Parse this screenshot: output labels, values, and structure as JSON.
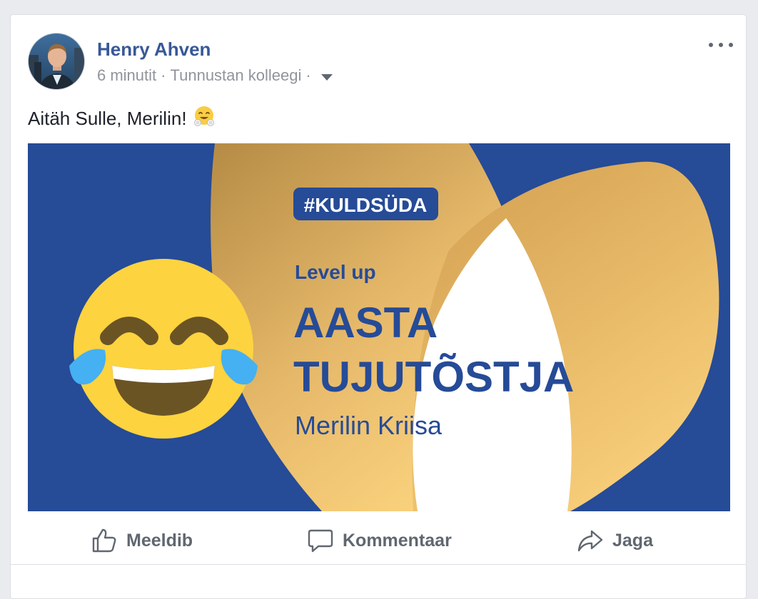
{
  "post": {
    "author": "Henry Ahven",
    "time": "6 minutit",
    "separator": "·",
    "audience": "Tunnustan kolleegi",
    "text": "Aitäh Sulle, Merilin!"
  },
  "image": {
    "hashtag": "#KULDSÜDA",
    "subtitle": "Level up",
    "title_line1": "AASTA",
    "title_line2": "TUJUTÕSTJA",
    "name": "Merilin Kriisa"
  },
  "actions": {
    "like": "Meeldib",
    "comment": "Kommentaar",
    "share": "Jaga"
  },
  "colors": {
    "author_link": "#385898",
    "meta_grey": "#90949c",
    "action_grey": "#606770",
    "image_blue": "#264b97",
    "gold_dark": "#b98f47",
    "gold_light": "#fbd37e",
    "emoji_yellow": "#fdd33f"
  },
  "icons": [
    "more-options-icon",
    "audience-dropdown-icon",
    "hugging-face-emoji-icon",
    "laughing-tears-emoji-icon",
    "like-thumb-icon",
    "comment-bubble-icon",
    "share-arrow-icon"
  ]
}
